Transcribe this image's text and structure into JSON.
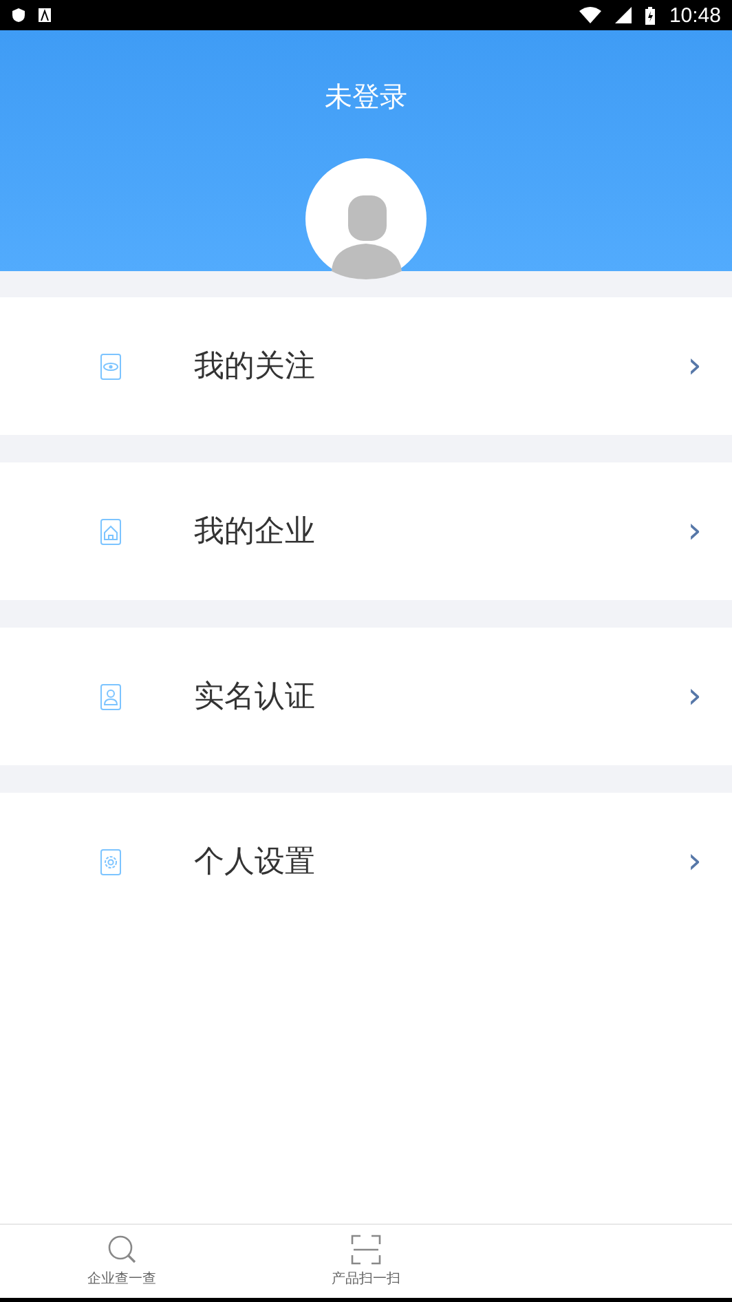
{
  "status_bar": {
    "time": "10:48"
  },
  "header": {
    "title": "未登录"
  },
  "menu": [
    {
      "kind": "follow",
      "label": "我的关注",
      "chevron": "›"
    },
    {
      "kind": "company",
      "label": "我的企业",
      "chevron": "›"
    },
    {
      "kind": "identity",
      "label": "实名认证",
      "chevron": "›"
    },
    {
      "kind": "settings",
      "label": "个人设置",
      "chevron": "›"
    }
  ],
  "tab_bar": [
    {
      "kind": "search",
      "label": "企业查一查"
    },
    {
      "kind": "scan",
      "label": "产品扫一扫"
    }
  ]
}
